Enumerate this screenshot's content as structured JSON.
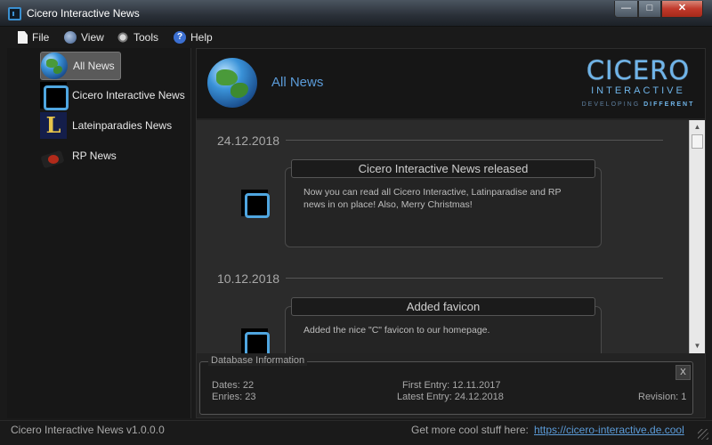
{
  "window": {
    "title": "Cicero Interactive News",
    "min_glyph": "—",
    "max_glyph": "□",
    "close_glyph": "✕"
  },
  "menu": [
    {
      "label": "File"
    },
    {
      "label": "View"
    },
    {
      "label": "Tools"
    },
    {
      "label": "Help"
    }
  ],
  "sidebar": {
    "items": [
      {
        "label": "All News",
        "icon": "globe-icon",
        "active": true
      },
      {
        "label": "Cicero Interactive News",
        "icon": "cicero-icon",
        "active": false
      },
      {
        "label": "Lateinparadies News",
        "icon": "lateinparadies-icon",
        "active": false
      },
      {
        "label": "RP News",
        "icon": "rp-icon",
        "active": false
      }
    ]
  },
  "header": {
    "title": "All News",
    "logo": {
      "main": "CICERO",
      "sub": "INTERACTIVE",
      "tag_prefix": "DEVELOPING",
      "tag_accent": "DIFFERENT"
    }
  },
  "news": [
    {
      "date": "24.12.2018",
      "title": "Cicero Interactive News released",
      "text": "Now you can read all Cicero Interactive, Latinparadise and RP news in on place! Also, Merry Christmas!"
    },
    {
      "date": "10.12.2018",
      "title": "Added favicon",
      "text": "Added the nice \"C\" favicon to our homepage."
    }
  ],
  "database": {
    "legend": "Database Information",
    "close_label": "X",
    "dates": "Dates: 22",
    "entries": "Enries: 23",
    "first_entry": "First Entry: 12.11.2017",
    "latest_entry": "Latest Entry: 24.12.2018",
    "revision": "Revision: 1"
  },
  "status": {
    "version": "Cicero Interactive News v1.0.0.0",
    "more_text": "Get more cool stuff here:",
    "link": "https://cicero-interactive.de.cool"
  },
  "colors": {
    "accent": "#5b9bd8",
    "close_red": "#c0392b",
    "background": "#1a1a1a"
  }
}
